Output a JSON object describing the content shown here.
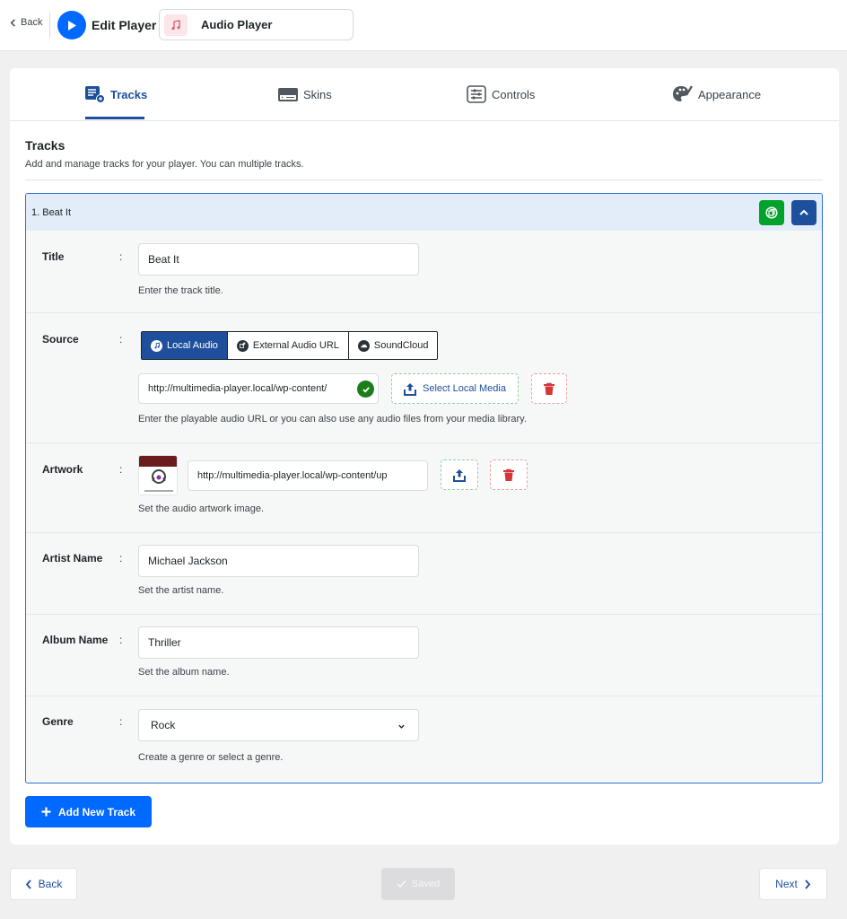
{
  "header": {
    "back_label": "Back",
    "edit_title": "Edit Player",
    "player_name": "Audio Player"
  },
  "tabs": [
    {
      "label": "Tracks",
      "icon": "tracks-icon",
      "active": true
    },
    {
      "label": "Skins",
      "icon": "skins-icon",
      "active": false
    },
    {
      "label": "Controls",
      "icon": "controls-icon",
      "active": false
    },
    {
      "label": "Appearance",
      "icon": "appearance-icon",
      "active": false
    }
  ],
  "section": {
    "title": "Tracks",
    "description": "Add and manage tracks for your player. You can multiple tracks."
  },
  "track": {
    "heading": "1. Beat It",
    "fields": {
      "title": {
        "label": "Title",
        "value": "Beat It",
        "help": "Enter the track title."
      },
      "source": {
        "label": "Source",
        "options": [
          "Local Audio",
          "External Audio URL",
          "SoundCloud"
        ],
        "selected": "Local Audio",
        "url": "http://multimedia-player.local/wp-content/",
        "select_media_label": "Select Local Media",
        "help": "Enter the playable audio URL or you can also use any audio files from your media library."
      },
      "artwork": {
        "label": "Artwork",
        "url": "http://multimedia-player.local/wp-content/up",
        "help": "Set the audio artwork image."
      },
      "artist": {
        "label": "Artist Name",
        "value": "Michael Jackson",
        "help": "Set the artist name."
      },
      "album": {
        "label": "Album Name",
        "value": "Thriller",
        "help": "Set the album name."
      },
      "genre": {
        "label": "Genre",
        "value": "Rock",
        "help": "Create a genre or select a genre."
      }
    },
    "colon": ":"
  },
  "add_track_label": "Add New Track",
  "footer": {
    "back_label": "Back",
    "saved_label": "Saved",
    "next_label": "Next"
  },
  "colors": {
    "primary": "#0069ff",
    "accent_navy": "#1e4f9d",
    "success": "#00a32a",
    "danger": "#d63638"
  }
}
